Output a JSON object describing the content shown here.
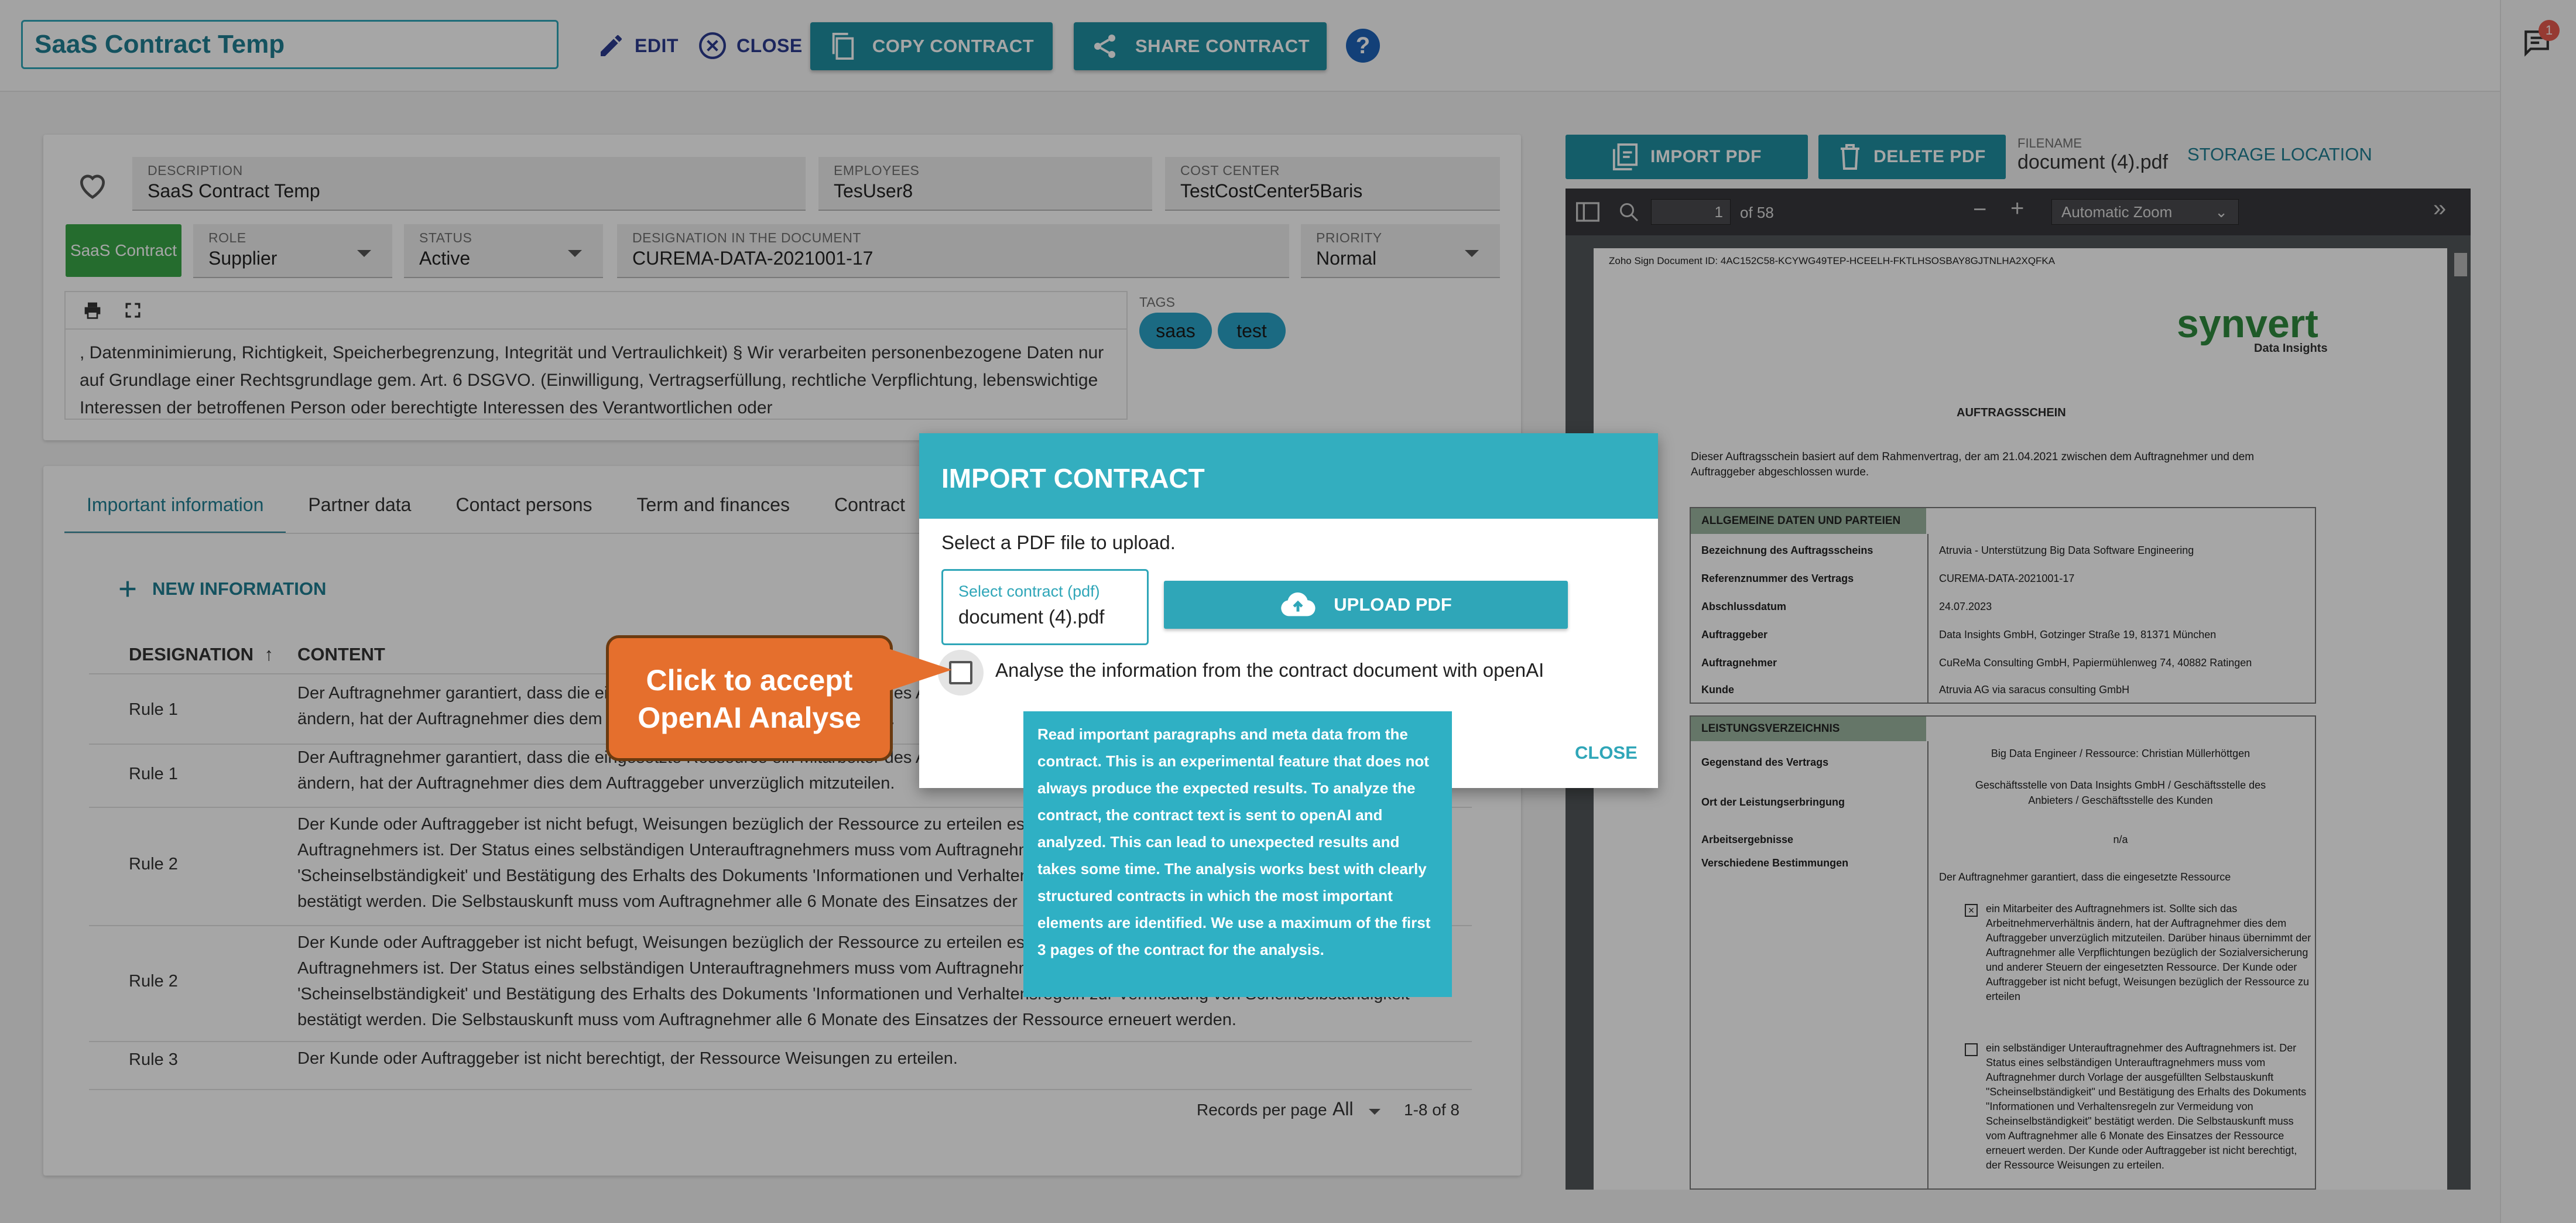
{
  "header": {
    "title": "SaaS Contract Temp",
    "edit_label": "EDIT",
    "close_label": "CLOSE",
    "copy_label": "COPY CONTRACT",
    "share_label": "SHARE CONTRACT",
    "help_label": "?",
    "notification_count": "1"
  },
  "contract": {
    "description": {
      "label": "DESCRIPTION",
      "value": "SaaS Contract Temp"
    },
    "employees": {
      "label": "EMPLOYEES",
      "value": "TesUser8"
    },
    "cost_center": {
      "label": "COST CENTER",
      "value": "TestCostCenter5Baris"
    },
    "type_badge": "SaaS Contract",
    "role": {
      "label": "ROLE",
      "value": "Supplier"
    },
    "status": {
      "label": "STATUS",
      "value": "Active"
    },
    "designation": {
      "label": "DESIGNATION IN THE DOCUMENT",
      "value": "CUREMA-DATA-2021001-17"
    },
    "priority": {
      "label": "PRIORITY",
      "value": "Normal"
    },
    "editor_text": ", Datenminimierung, Richtigkeit, Speicherbegrenzung, Integrität und Vertraulichkeit) § Wir verarbeiten personenbezogene Daten nur auf Grundlage einer Rechtsgrundlage gem. Art. 6 DSGVO. (Einwilligung, Vertragserfüllung, rechtliche Verpflichtung, lebenswichtige Interessen der betroffenen Person oder berechtigte Interessen des Verantwortlichen oder",
    "tags_label": "TAGS",
    "tags": [
      "saas",
      "test"
    ]
  },
  "tabs": [
    "Important information",
    "Partner data",
    "Contact persons",
    "Term and finances",
    "Contract"
  ],
  "info": {
    "new_label": "NEW INFORMATION",
    "col_designation": "DESIGNATION",
    "col_content": "CONTENT",
    "rows": [
      {
        "name": "Rule 1",
        "lines": [
          "Der Auftragnehmer garantiert, dass die eingesetzte Ressource ein Mitarbeiter des Auftragnehmers ist. Sollte sich das Arbeitnehmerverhältnis",
          "ändern, hat der Auftragnehmer dies dem Auftraggeber unverzüglich mitzuteilen."
        ]
      },
      {
        "name": "Rule 1",
        "lines": [
          "Der Auftragnehmer garantiert, dass die eingesetzte Ressource ein Mitarbeiter des Auftragnehmers ist. Sollte sich das Arbeitnehmerverhältnis",
          "ändern, hat der Auftragnehmer dies dem Auftraggeber unverzüglich mitzuteilen."
        ]
      },
      {
        "name": "Rule 2",
        "lines": [
          "Der Kunde oder Auftraggeber ist nicht befugt, Weisungen bezüglich der Ressource zu erteilen es sei denn, es handelt sich um einen Mitarbeiter des",
          "Auftragnehmers ist. Der Status eines selbständigen Unterauftragnehmers muss vom Auftragnehmer durch Vorlage der ausgefüllten Selbstauskunft",
          "'Scheinselbständigkeit' und Bestätigung des Erhalts des Dokuments 'Informationen und Verhaltensregeln zur Vermeidung von Scheinselbständigkeit'",
          "bestätigt werden. Die Selbstauskunft muss vom Auftragnehmer alle 6 Monate des Einsatzes der Ressource erneuert werden."
        ]
      },
      {
        "name": "Rule 2",
        "lines": [
          "Der Kunde oder Auftraggeber ist nicht befugt, Weisungen bezüglich der Ressource zu erteilen es sei denn, es handelt sich um einen Mitarbeiter des",
          "Auftragnehmers ist. Der Status eines selbständigen Unterauftragnehmers muss vom Auftragnehmer durch Vorlage der ausgefüllten Selbstauskunft",
          "'Scheinselbständigkeit' und Bestätigung des Erhalts des Dokuments 'Informationen und Verhaltensregeln zur Vermeidung von Scheinselbständigkeit'",
          "bestätigt werden. Die Selbstauskunft muss vom Auftragnehmer alle 6 Monate des Einsatzes der Ressource erneuert werden."
        ]
      },
      {
        "name": "Rule 3",
        "lines": [
          "Der Kunde oder Auftraggeber ist nicht berechtigt, der Ressource Weisungen zu erteilen."
        ]
      }
    ],
    "records_per_page_label": "Records per page",
    "records_per_page_value": "All",
    "range": "1-8 of 8"
  },
  "pdf_panel": {
    "import_label": "IMPORT PDF",
    "delete_label": "DELETE PDF",
    "filename_label": "FILENAME",
    "filename": "document (4).pdf",
    "storage_label": "STORAGE LOCATION",
    "page_number": "1",
    "page_total": "of 58",
    "zoom": "Automatic Zoom",
    "doc": {
      "sign_id": "Zoho Sign Document ID: 4AC152C58-KCYWG49TEP-HCEELH-FKTLHSOSBAY8GJTNLHA2XQFKA",
      "logo": "synvert",
      "logo_sub": "Data Insights",
      "heading": "AUFTRAGSSCHEIN",
      "intro_1": "Dieser Auftragsschein basiert auf dem Rahmenvertrag, der am 21.04.2021 zwischen dem Auftragnehmer und dem",
      "intro_2": "Auftraggeber abgeschlossen wurde.",
      "section_1": "ALLGEMEINE DATEN UND PARTEIEN",
      "rows_1": [
        {
          "k": "Bezeichnung des Auftragsscheins",
          "v": "Atruvia - Unterstützung Big Data Software Engineering"
        },
        {
          "k": "Referenznummer des Vertrags",
          "v": "CUREMA-DATA-2021001-17"
        },
        {
          "k": "Abschlussdatum",
          "v": "24.07.2023"
        },
        {
          "k": "Auftraggeber",
          "v": "Data Insights GmbH, Gotzinger Straße 19, 81371 München"
        },
        {
          "k": "Auftragnehmer",
          "v": "CuReMa Consulting GmbH, Papiermühlenweg 74, 40882 Ratingen"
        },
        {
          "k": "Kunde",
          "v": "Atruvia AG via saracus consulting GmbH"
        }
      ],
      "section_2": "LEISTUNGSVERZEICHNIS",
      "rows_2": [
        {
          "k": "Gegenstand des Vertrags",
          "v": "Big Data Engineer / Ressource: Christian Müllerhöttgen"
        },
        {
          "k": "Ort der Leistungserbringung",
          "v": "Geschäftsstelle von Data Insights GmbH / Geschäftsstelle des Anbieters / Geschäftsstelle des Kunden"
        },
        {
          "k": "Arbeitsergebnisse",
          "v": "n/a"
        },
        {
          "k": "Verschiedene Bestimmungen",
          "v": "Der Auftragnehmer garantiert, dass die eingesetzte Ressource"
        }
      ],
      "clause_1": "ein Mitarbeiter des Auftragnehmers ist. Sollte sich das Arbeitnehmerverhältnis ändern, hat der Auftragnehmer dies dem Auftraggeber unverzüglich mitzuteilen. Darüber hinaus übernimmt der Auftragnehmer alle Verpflichtungen bezüglich der Sozialversicherung und anderer Steuern der eingesetzten Ressource. Der Kunde oder Auftraggeber ist nicht befugt, Weisungen bezüglich der Ressource zu erteilen",
      "clause_2": "ein selbständiger Unterauftragnehmer des Auftragnehmers ist. Der Status eines selbständigen Unterauftragnehmers muss vom Auftragnehmer durch Vorlage der ausgefüllten Selbstauskunft \"Scheinselbständigkeit\" und Bestätigung des Erhalts des Dokuments \"Informationen und Verhaltensregeln zur Vermeidung von Scheinselbständigkeit\" bestätigt werden. Die Selbstauskunft muss vom Auftragnehmer alle 6 Monate des Einsatzes der Ressource erneuert werden. Der Kunde oder Auftraggeber ist nicht berechtigt, der Ressource Weisungen zu erteilen."
    }
  },
  "dialog": {
    "title": "IMPORT CONTRACT",
    "subtitle": "Select a PDF file to upload.",
    "select_label": "Select contract (pdf)",
    "select_value": "document (4).pdf",
    "upload_label": "UPLOAD PDF",
    "checkbox_label": "Analyse the information from the contract document with openAI",
    "close_label": "CLOSE",
    "tooltip": "Read important paragraphs and meta data from the contract. This is an experimental feature that does not always produce the expected results. To analyze the contract, the contract text is sent to openAI and analyzed. This can lead to unexpected results and takes some time. The analysis works best with clearly structured contracts in which the most important elements are identified. We use a maximum of the first 3 pages of the contract for the analysis."
  },
  "callout": {
    "line1": "Click to accept",
    "line2": "OpenAI Analyse"
  },
  "colors": {
    "accent": "#2fa6b8",
    "button": "#1f8fa1",
    "callout": "#e56f2d",
    "badge": "#3aa648"
  }
}
